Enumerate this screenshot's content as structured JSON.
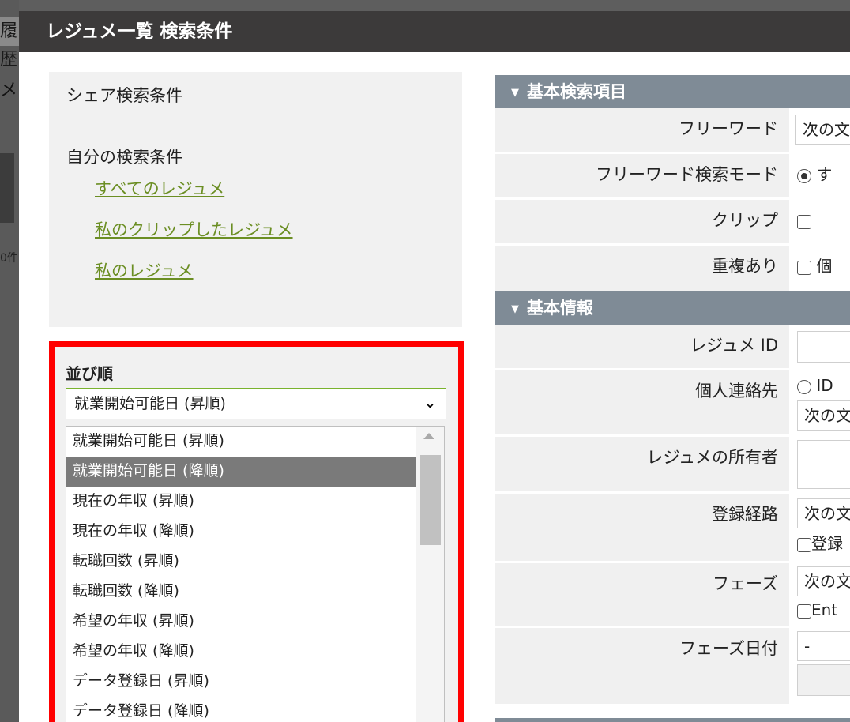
{
  "background": {
    "edge_text_1": "履歴",
    "edge_text_2": "メ",
    "edge_text_3": "0件"
  },
  "modal": {
    "title": "レジュメ一覧 検索条件"
  },
  "saved_searches": {
    "share_heading": "シェア検索条件",
    "mine_heading": "自分の検索条件",
    "links": [
      "すべてのレジュメ",
      "私のクリップしたレジュメ",
      "私のレジュメ"
    ]
  },
  "sort": {
    "label": "並び順",
    "selected": "就業開始可能日 (昇順)",
    "options": [
      "就業開始可能日 (昇順)",
      "就業開始可能日 (降順)",
      "現在の年収 (昇順)",
      "現在の年収 (降順)",
      "転職回数 (昇順)",
      "転職回数 (降順)",
      "希望の年収 (昇順)",
      "希望の年収 (降順)",
      "データ登録日 (昇順)",
      "データ登録日 (降順)"
    ],
    "highlighted_index": 1
  },
  "form": {
    "basic_search": {
      "heading": "基本検索項目",
      "free_word_label": "フリーワード",
      "free_word_value": "次の文",
      "free_word_mode_label": "フリーワード検索モード",
      "free_word_mode_value": "す",
      "clip_label": "クリップ",
      "duplicate_label": "重複あり",
      "duplicate_value": "個"
    },
    "basic_info": {
      "heading": "基本情報",
      "resume_id_label": "レジュメ ID",
      "contact_label": "個人連絡先",
      "contact_radio_value": "ID",
      "contact_select_value": "次の文",
      "owner_label": "レジュメの所有者",
      "route_label": "登録経路",
      "route_select_value": "次の文",
      "route_check_value": "登録",
      "phase_label": "フェーズ",
      "phase_select_value": "次の文",
      "phase_check_value": "Ent",
      "phase_date_label": "フェーズ日付",
      "phase_date_value": "-"
    }
  }
}
